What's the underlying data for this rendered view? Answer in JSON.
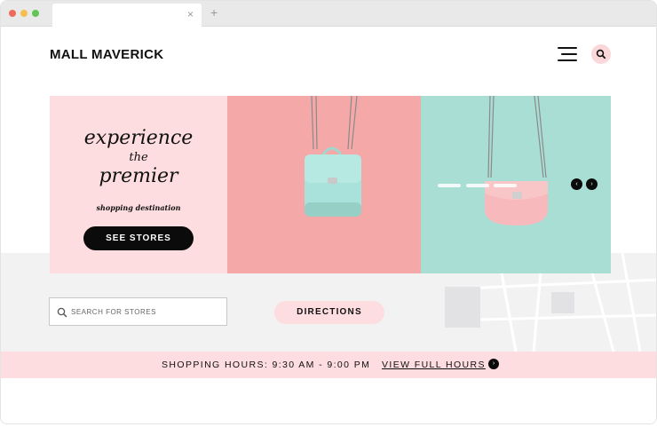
{
  "browser": {
    "tab_close_glyph": "×",
    "new_tab_glyph": "+",
    "icons": [
      "close-tab-icon",
      "new-tab-icon"
    ]
  },
  "header": {
    "logo": "MALL MAVERICK",
    "icons": [
      "hamburger-menu-icon",
      "search-icon"
    ]
  },
  "hero": {
    "headline_line1": "experience",
    "headline_line2": "the",
    "headline_line3": "premier",
    "tagline": "shopping destination",
    "cta_label": "SEE STORES",
    "slide_count": 3,
    "active_slide": 1,
    "prev_glyph": "‹",
    "next_glyph": "›",
    "colors": {
      "left_panel": "#fddde0",
      "middle_panel": "#f5a8a8",
      "right_panel": "#a9ded5",
      "bag_mint": "#a8e2da",
      "bag_pink": "#f7b9bb"
    }
  },
  "search": {
    "placeholder": "SEARCH FOR STORES",
    "value": ""
  },
  "directions": {
    "label": "DIRECTIONS"
  },
  "hours": {
    "text": "SHOPPING HOURS: 9:30 AM - 9:00 PM",
    "link_label": "VIEW FULL HOURS",
    "arrow_glyph": "›"
  },
  "colors": {
    "accent_pink": "#fddde0",
    "dark": "#0b0b0b",
    "map_gray": "#f2f2f3"
  }
}
